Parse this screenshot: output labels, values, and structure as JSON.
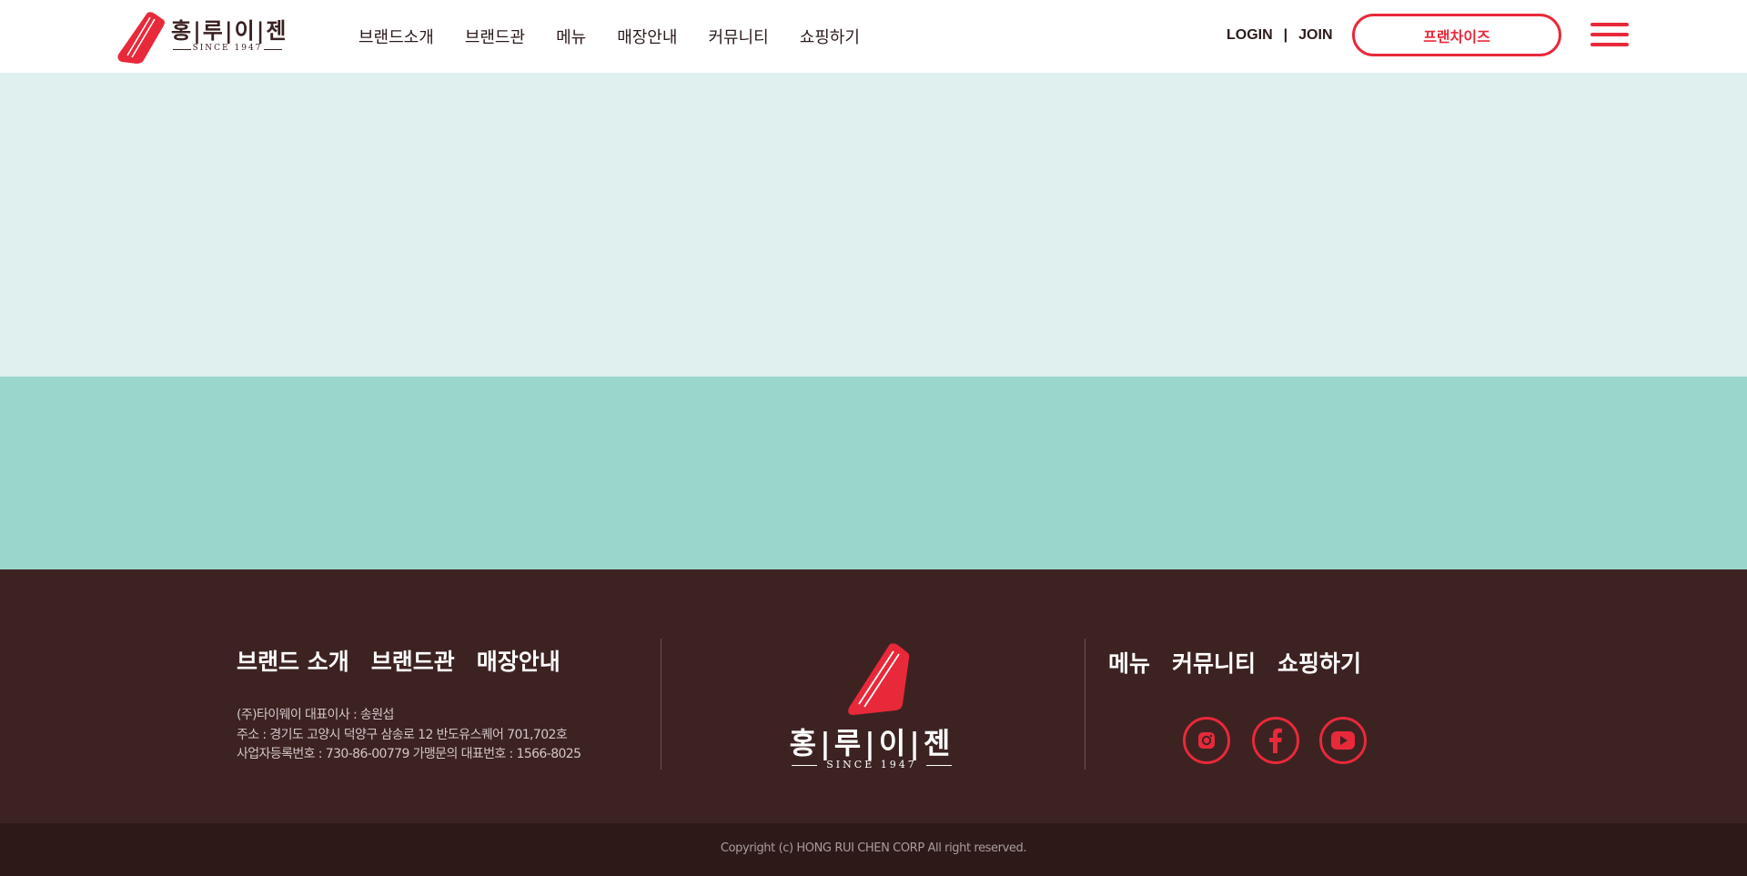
{
  "header": {
    "logo": {
      "name": "홍|루|이|젠",
      "since": "SINCE 1947"
    },
    "nav": [
      "브랜드소개",
      "브랜드관",
      "메뉴",
      "매장안내",
      "커뮤니티",
      "쇼핑하기"
    ],
    "login_label": "LOGIN",
    "separator": "|",
    "join_label": "JOIN",
    "franchise_label": "프랜차이즈",
    "menu_icon": "hamburger-icon"
  },
  "footer": {
    "links_left": [
      "브랜드 소개",
      "브랜드관",
      "매장안내"
    ],
    "info_lines": [
      "(주)타이웨이 대표이사 : 송원섭",
      "주소 : 경기도 고양시 덕양구 삼송로 12 반도유스퀘어 701,702호",
      "사업자등록번호 : 730-86-00779 가맹문의 대표번호 : 1566-8025"
    ],
    "logo": {
      "name": "홍|루|이|젠",
      "since": "SINCE 1947"
    },
    "links_right": [
      "메뉴",
      "커뮤니티",
      "쇼핑하기"
    ],
    "social_icons": [
      "instagram-icon",
      "facebook-icon",
      "youtube-icon"
    ],
    "copyright": "Copyright (c) HONG RUI CHEN CORP All right reserved."
  },
  "colors": {
    "accent": "#e8293a",
    "header_bg": "#ffffff",
    "band_light": "#dff0ee",
    "band_mint": "#9ad6cc",
    "footer_bg": "#3d2222",
    "copyright_bg": "#2e1919",
    "text_dark": "#2c1b1b"
  }
}
